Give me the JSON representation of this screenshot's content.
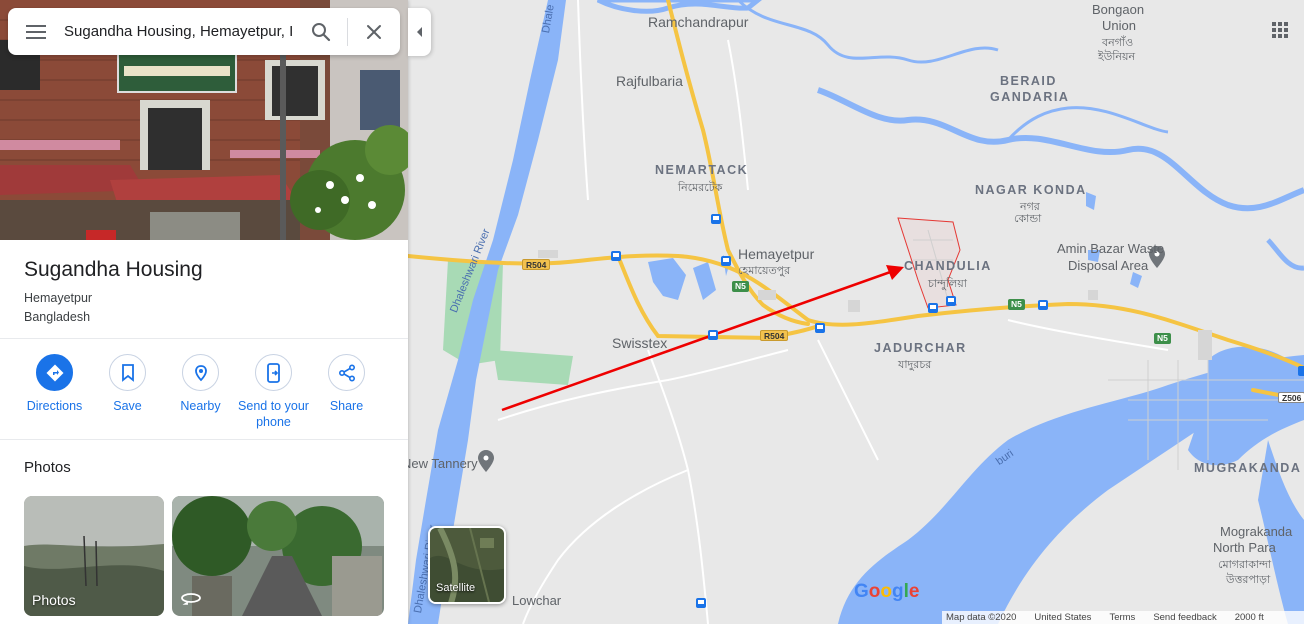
{
  "search": {
    "value": "Sugandha Housing, Hemayetpur, I"
  },
  "place": {
    "title": "Sugandha Housing",
    "locality": "Hemayetpur",
    "country": "Bangladesh"
  },
  "actions": [
    {
      "label": "Directions",
      "icon": "directions-icon"
    },
    {
      "label": "Save",
      "icon": "bookmark-icon"
    },
    {
      "label": "Nearby",
      "icon": "nearby-icon"
    },
    {
      "label": "Send to your phone",
      "icon": "send-to-phone-icon"
    },
    {
      "label": "Share",
      "icon": "share-icon"
    }
  ],
  "photos": {
    "heading": "Photos",
    "tiles": [
      {
        "label": "Photos"
      },
      {
        "label": "",
        "icon": "street-view-360-icon"
      }
    ]
  },
  "map": {
    "labels": {
      "ramchandrapur": "Ramchandrapur",
      "rajfulbaria": "Rajfulbaria",
      "nemartack": "NEMARTACK",
      "nemartack_bn": "নিমেরটেক",
      "hemayetpur": "Hemayetpur",
      "hemayetpur_bn": "হেমায়েতপুর",
      "swisstex": "Swisstex",
      "chandulia": "CHANDULIA",
      "chandulia_bn": "চান্দুলিয়া",
      "jadurchar": "JADURCHAR",
      "jadurchar_bn": "যাদুরচর",
      "nagar_konda": "NAGAR KONDA",
      "nagar_konda_bn1": "নগর",
      "nagar_konda_bn2": "কোন্ডা",
      "beraid": "BERAID",
      "gandaria": "GANDARIA",
      "bongaon": "Bongaon",
      "union": "Union",
      "bongaon_bn1": "বনগাঁও",
      "bongaon_bn2": "ইউনিয়ন",
      "amin_bazar_1": "Amin Bazar Waste",
      "amin_bazar_2": "Disposal Area",
      "new_tannery": "New Tannery",
      "mugrakanda": "MUGRAKANDA",
      "mograkanda_1": "Mograkanda",
      "mograkanda_2": "North Para",
      "mograkanda_bn1": "মোগরাকান্দা",
      "mograkanda_bn2": "উত্তরপাড়া",
      "dhaleshwari_1": "Dhaleshwari River",
      "dhaleshwari_2": "Dhaleshwari River",
      "dhale_top": "Dhale",
      "buri": "buri",
      "lowchar": "Lowchar"
    },
    "shields": {
      "r504a": "R504",
      "r504b": "R504",
      "n5a": "N5",
      "n5b": "N5",
      "n5c": "N5",
      "z506": "Z506"
    },
    "satellite_label": "Satellite",
    "google_logo": "Google",
    "attribution": {
      "map_data": "Map data ©2020",
      "country": "United States",
      "terms": "Terms",
      "feedback": "Send feedback",
      "scale": "2000 ft"
    },
    "colors": {
      "water": "#8ab4f8",
      "road_major": "#f5c443",
      "land": "#e8e8e8",
      "park": "#a8dab5",
      "boundary": "#e53935",
      "arrow": "#ee0000"
    }
  }
}
